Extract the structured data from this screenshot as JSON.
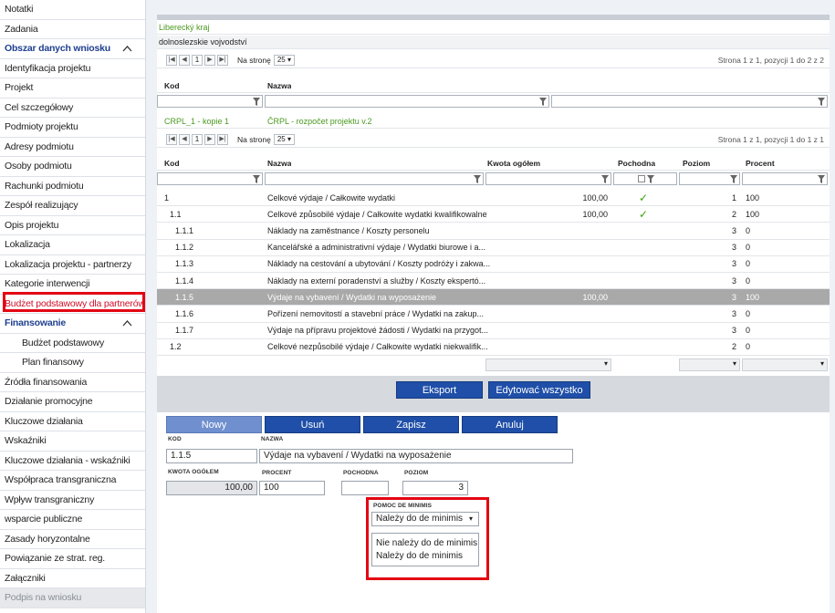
{
  "sidebar": {
    "items": [
      {
        "label": "Notatki",
        "style": ""
      },
      {
        "label": "Zadania",
        "style": ""
      },
      {
        "label": "Obszar danych wniosku",
        "style": "blue",
        "caret": true
      },
      {
        "label": "Identyfikacja projektu",
        "style": ""
      },
      {
        "label": "Projekt",
        "style": ""
      },
      {
        "label": "Cel szczegółowy",
        "style": ""
      },
      {
        "label": "Podmioty projektu",
        "style": ""
      },
      {
        "label": "Adresy podmiotu",
        "style": ""
      },
      {
        "label": "Osoby podmiotu",
        "style": ""
      },
      {
        "label": "Rachunki podmiotu",
        "style": ""
      },
      {
        "label": "Zespół realizujący",
        "style": ""
      },
      {
        "label": "Opis projektu",
        "style": ""
      },
      {
        "label": "Lokalizacja",
        "style": ""
      },
      {
        "label": "Lokalizacja projektu - partnerzy",
        "style": ""
      },
      {
        "label": "Kategorie interwencji",
        "style": ""
      },
      {
        "label": "Budżet podstawowy dla partnerów",
        "style": "active"
      },
      {
        "label": "Finansowanie",
        "style": "blue",
        "caret": true
      },
      {
        "label": "Budżet podstawowy",
        "style": "sub"
      },
      {
        "label": "Plan finansowy",
        "style": "sub"
      },
      {
        "label": "Źródła finansowania",
        "style": ""
      },
      {
        "label": "Działanie promocyjne",
        "style": ""
      },
      {
        "label": "Kluczowe działania",
        "style": ""
      },
      {
        "label": "Wskaźniki",
        "style": ""
      },
      {
        "label": "Kluczowe działania - wskaźniki",
        "style": ""
      },
      {
        "label": "Współpraca transgraniczna",
        "style": ""
      },
      {
        "label": "Wpływ transgraniczny",
        "style": ""
      },
      {
        "label": "wsparcie publiczne",
        "style": ""
      },
      {
        "label": "Zasady horyzontalne",
        "style": ""
      },
      {
        "label": "Powiązanie ze strat. reg.",
        "style": ""
      },
      {
        "label": "Załączniki",
        "style": ""
      },
      {
        "label": "Podpis na wniosku",
        "style": "grey"
      }
    ]
  },
  "top": {
    "region": "Liberecký kraj",
    "region_pl": "dolnoslezskie vojvodství"
  },
  "pager1": {
    "page": "1",
    "label": "Na stronę",
    "size": "25",
    "info": "Strona 1 z 1, pozycji 1 do 2 z 2"
  },
  "table1": {
    "headers": [
      "Kod",
      "Nazwa"
    ],
    "row": {
      "kod": "CRPL_1 - kopie 1",
      "nazwa": "ČRPL - rozpočet projektu v.2"
    }
  },
  "pager2": {
    "page": "1",
    "label": "Na stronę",
    "size": "25",
    "info": "Strona 1 z 1, pozycji 1 do 1 z 1"
  },
  "table2": {
    "headers": [
      "Kod",
      "Nazwa",
      "Kwota ogółem",
      "Pochodna",
      "Poziom",
      "Procent"
    ],
    "rows": [
      {
        "kod": "1",
        "nazwa": "Celkové výdaje / Całkowite wydatki",
        "kwota": "100,00",
        "pochodna": "✓",
        "poziom": "1",
        "procent": "100"
      },
      {
        "kod": "1.1",
        "nazwa": "Celkové způsobilé výdaje / Całkowite wydatki kwalifikowalne",
        "kwota": "100,00",
        "pochodna": "✓",
        "poziom": "2",
        "procent": "100"
      },
      {
        "kod": "1.1.1",
        "nazwa": "Náklady na zaměstnance / Koszty personelu",
        "kwota": "",
        "pochodna": "",
        "poziom": "3",
        "procent": "0"
      },
      {
        "kod": "1.1.2",
        "nazwa": "Kancelářské a administrativní výdaje / Wydatki biurowe i a...",
        "kwota": "",
        "pochodna": "",
        "poziom": "3",
        "procent": "0"
      },
      {
        "kod": "1.1.3",
        "nazwa": "Náklady na cestování a ubytování / Koszty podróży i zakwa...",
        "kwota": "",
        "pochodna": "",
        "poziom": "3",
        "procent": "0"
      },
      {
        "kod": "1.1.4",
        "nazwa": "Náklady na externí poradenství a služby / Koszty ekspertó...",
        "kwota": "",
        "pochodna": "",
        "poziom": "3",
        "procent": "0"
      },
      {
        "kod": "1.1.5",
        "nazwa": "Výdaje na vybavení / Wydatki na wyposażenie",
        "kwota": "100,00",
        "pochodna": "",
        "poziom": "3",
        "procent": "100",
        "selected": true
      },
      {
        "kod": "1.1.6",
        "nazwa": "Pořízení nemovitostí a stavební práce / Wydatki na zakup...",
        "kwota": "",
        "pochodna": "",
        "poziom": "3",
        "procent": "0"
      },
      {
        "kod": "1.1.7",
        "nazwa": "Výdaje na přípravu projektové žádosti / Wydatki na przygot...",
        "kwota": "",
        "pochodna": "",
        "poziom": "3",
        "procent": "0"
      },
      {
        "kod": "1.2",
        "nazwa": "Celkové nezpůsobilé výdaje / Całkowite wydatki niekwalifik...",
        "kwota": "",
        "pochodna": "",
        "poziom": "2",
        "procent": "0"
      }
    ]
  },
  "buttons": {
    "export": "Eksport",
    "edit_all": "Edytować wszystko",
    "new": "Nowy",
    "delete": "Usuń",
    "save": "Zapisz",
    "cancel": "Anuluj"
  },
  "form": {
    "kod_label": "KOD",
    "kod": "1.1.5",
    "nazwa_label": "NAZWA",
    "nazwa": "Výdaje na vybavení / Wydatki na wyposażenie",
    "kwota_label": "KWOTA OGÓŁEM",
    "kwota": "100,00",
    "procent_label": "PROCENT",
    "procent": "100",
    "pochodna_label": "POCHODNA",
    "pochodna": "",
    "poziom_label": "POZIOM",
    "poziom": "3",
    "deminimis_label": "POMOC DE MINIMIS",
    "deminimis": "Należy do de minimis",
    "deminimis_options": [
      "Nie należy do de minimis",
      "Należy do de minimis"
    ]
  },
  "colors": {
    "accent": "#1f4fa8",
    "highlight": "#e30613",
    "selected_row": "#a9a9a9",
    "green_text": "#4a9a1f"
  }
}
